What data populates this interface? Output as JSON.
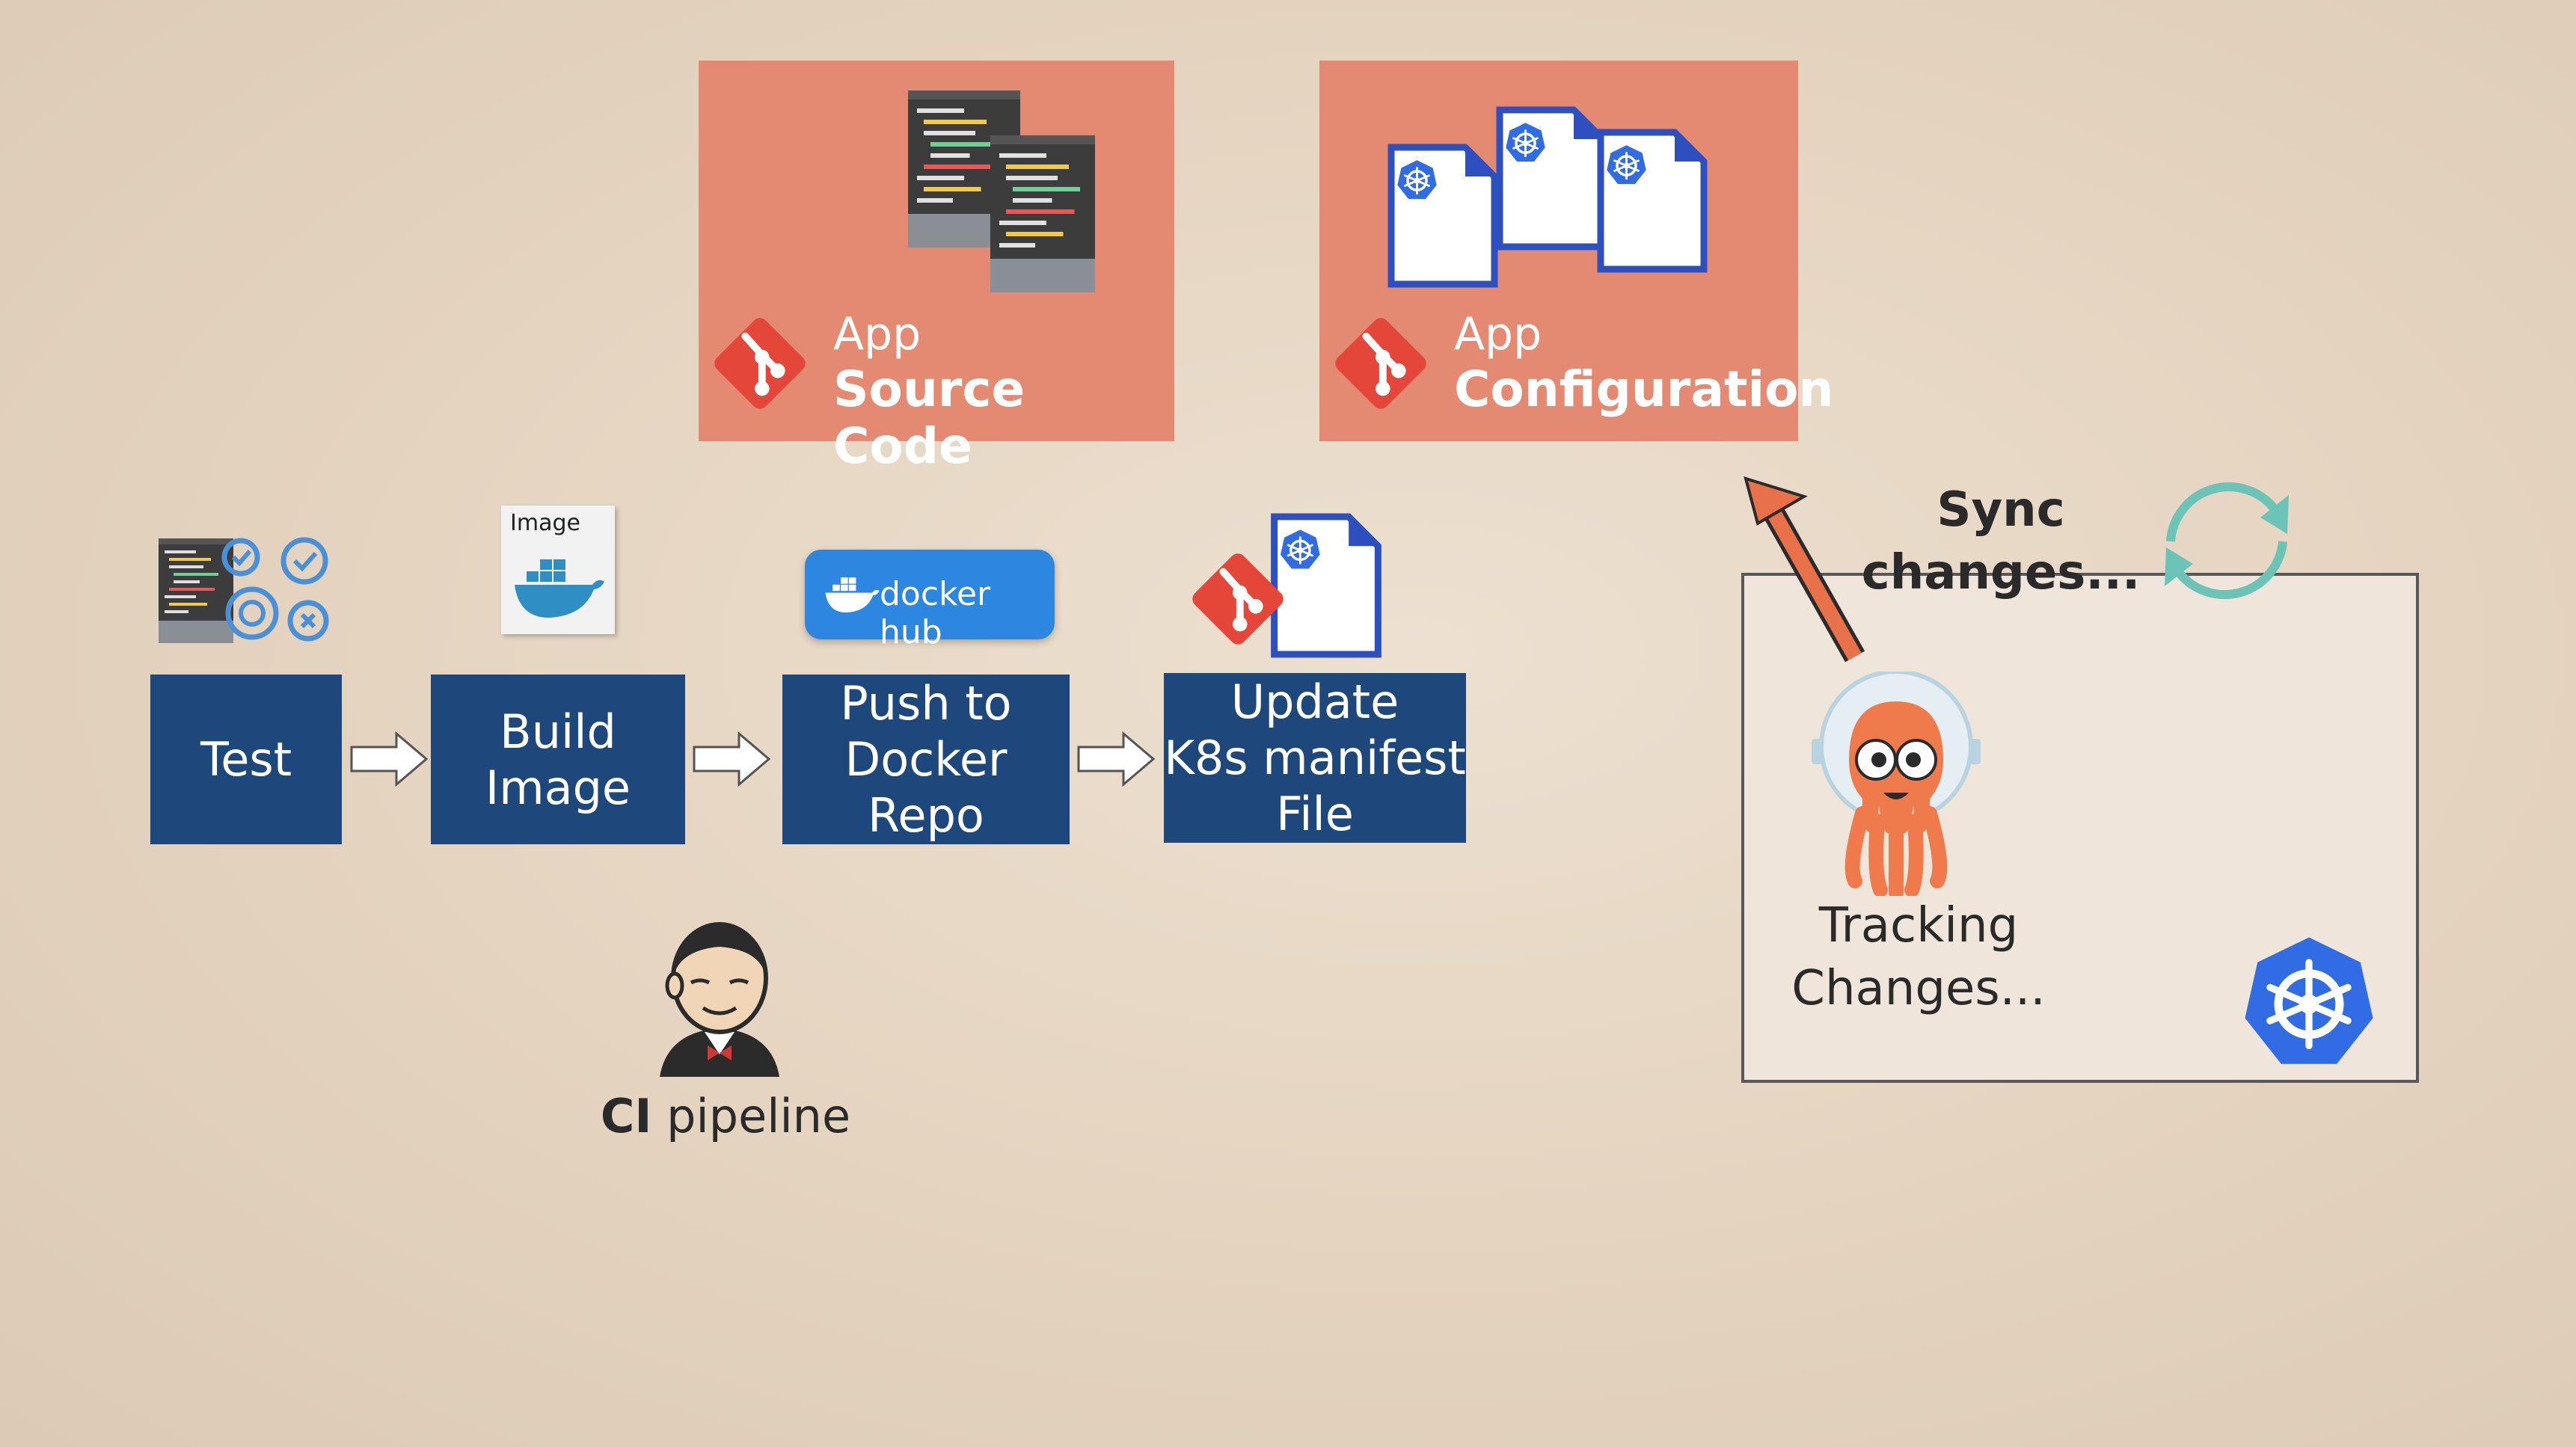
{
  "repos": [
    {
      "line1": "App",
      "line2": "Source Code"
    },
    {
      "line1": "App",
      "line2": "Configuration"
    }
  ],
  "pipeline": {
    "steps": [
      {
        "label": "Test"
      },
      {
        "label": "Build\nImage"
      },
      {
        "label": "Push to\nDocker Repo"
      },
      {
        "label": "Update\nK8s manifest\nFile"
      }
    ],
    "image_card_label": "Image",
    "dockerhub_label": "docker hub"
  },
  "ci": {
    "bold": "CI",
    "rest": " pipeline"
  },
  "argo": {
    "sync_label": "Sync\nchanges...",
    "tracking_label": "Tracking\nChanges..."
  },
  "colors": {
    "repo_card": "#e58a72",
    "step_box": "#1e477c",
    "git_red": "#e4473a",
    "k8s_blue": "#326ce5",
    "sync_teal": "#6cc4b8",
    "argo_orange": "#ef7b4d",
    "push_arrow": "#e8714a"
  },
  "icons": [
    "git-icon",
    "code-documents-icon",
    "k8s-manifest-icon",
    "gears-icon",
    "docker-whale-icon",
    "dockerhub-logo",
    "jenkins-icon",
    "argo-octopus-icon",
    "sync-icon",
    "kubernetes-icon"
  ]
}
